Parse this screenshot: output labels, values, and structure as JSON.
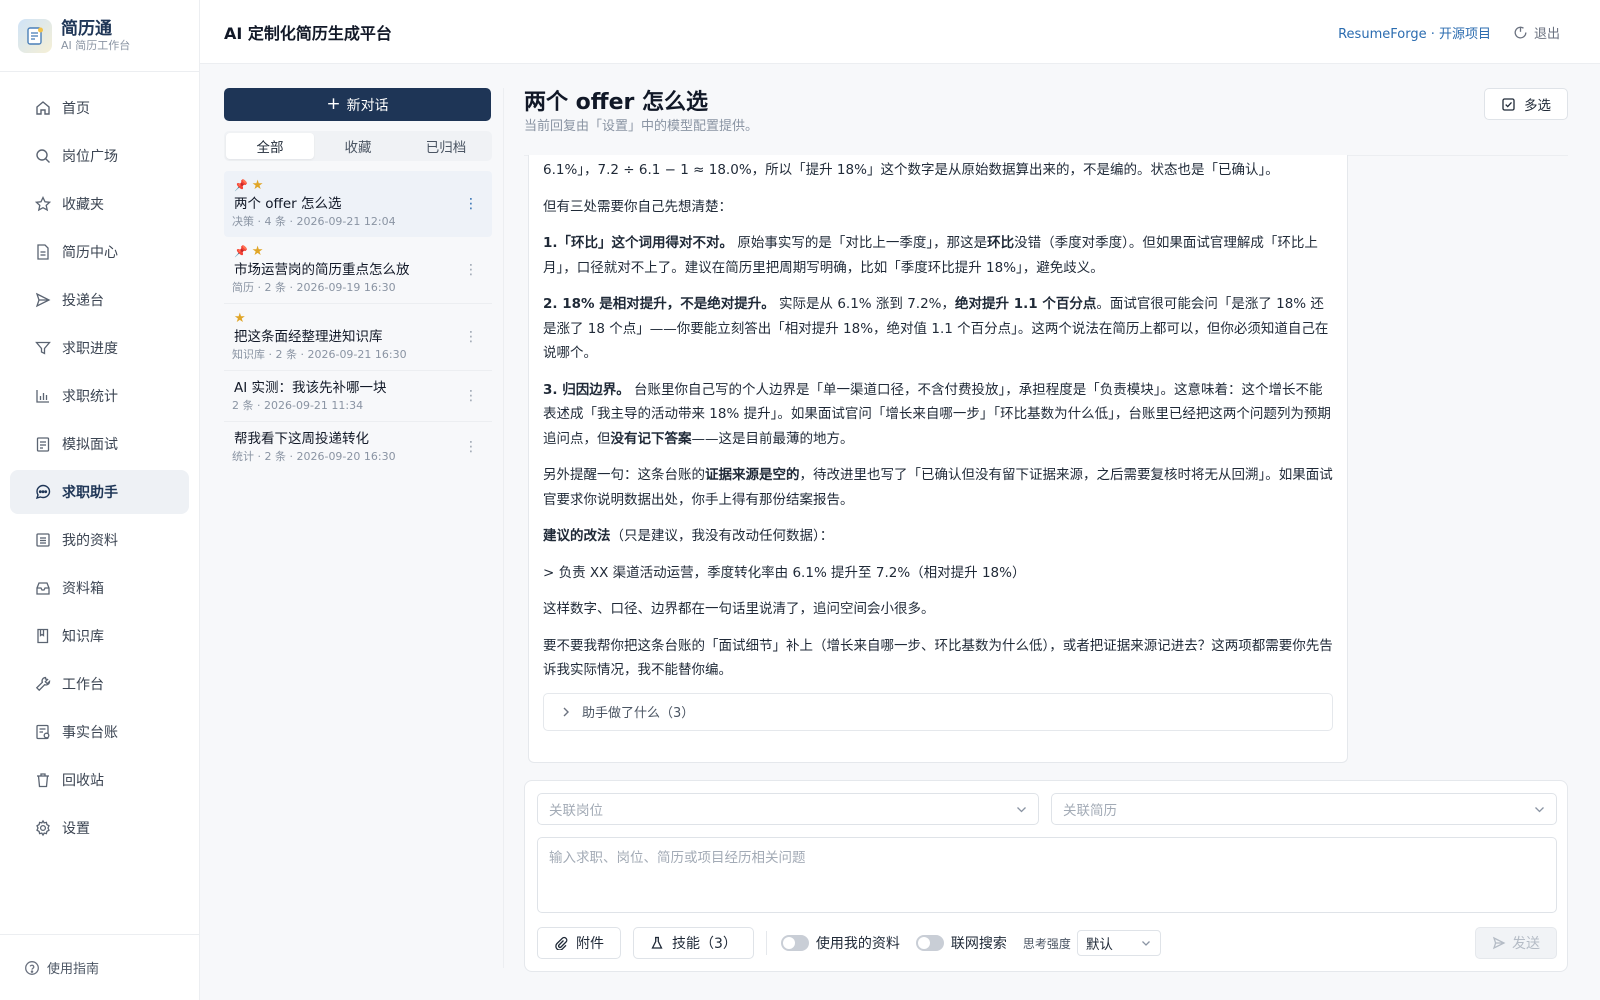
{
  "brand": {
    "name": "简历通",
    "subtitle": "AI 简历工作台"
  },
  "sidebar": {
    "items": [
      {
        "label": "首页",
        "icon": "home-icon"
      },
      {
        "label": "岗位广场",
        "icon": "search-icon"
      },
      {
        "label": "收藏夹",
        "icon": "star-icon"
      },
      {
        "label": "简历中心",
        "icon": "document-icon"
      },
      {
        "label": "投递台",
        "icon": "send-icon"
      },
      {
        "label": "求职进度",
        "icon": "filter-icon"
      },
      {
        "label": "求职统计",
        "icon": "bar-chart-icon"
      },
      {
        "label": "模拟面试",
        "icon": "clipboard-icon"
      },
      {
        "label": "求职助手",
        "icon": "chat-bubble-icon",
        "active": true
      },
      {
        "label": "我的资料",
        "icon": "list-icon"
      },
      {
        "label": "资料箱",
        "icon": "inbox-icon"
      },
      {
        "label": "知识库",
        "icon": "book-icon"
      },
      {
        "label": "工作台",
        "icon": "wrench-icon"
      },
      {
        "label": "事实台账",
        "icon": "ledger-icon"
      },
      {
        "label": "回收站",
        "icon": "trash-icon"
      },
      {
        "label": "设置",
        "icon": "gear-icon"
      }
    ],
    "guide_label": "使用指南"
  },
  "header": {
    "title": "AI 定制化简历生成平台",
    "project_link_a": "ResumeForge · ",
    "project_link_b": "开源项目",
    "logout_label": "退出"
  },
  "conversations": {
    "new_label": "新对话",
    "tabs": [
      "全部",
      "收藏",
      "已归档"
    ],
    "active_tab": "全部",
    "items": [
      {
        "title": "两个 offer 怎么选",
        "meta": "决策 · 4 条 · 2026-09-21 12:04",
        "pinned": true,
        "starred": true,
        "active": true
      },
      {
        "title": "市场运营岗的简历重点怎么放",
        "meta": "简历 · 2 条 · 2026-09-19 16:30",
        "pinned": true,
        "starred": true
      },
      {
        "title": "把这条面经整理进知识库",
        "meta": "知识库 · 2 条 · 2026-09-21 16:30",
        "pinned": false,
        "starred": true
      },
      {
        "title": "AI 实测：我该先补哪一块",
        "meta": "2 条 · 2026-09-21 11:34",
        "pinned": false,
        "starred": false
      },
      {
        "title": "帮我看下这周投递转化",
        "meta": "统计 · 2 条 · 2026-09-20 16:30",
        "pinned": false,
        "starred": false
      }
    ]
  },
  "chat": {
    "title": "两个 offer 怎么选",
    "subtitle": "当前回复由「设置」中的模型配置提供。",
    "multi_select_label": "多选",
    "message": {
      "p0": "6.1%」，7.2 ÷ 6.1 − 1 ≈ 18.0%，所以「提升 18%」这个数字是从原始数据算出来的，不是编的。状态也是「已确认」。",
      "p1": "但有三处需要你自己先想清楚：",
      "p2_bold": "1.「环比」这个词用得对不对。",
      "p2_a": " 原始事实写的是「对比上一季度」，那这是",
      "p2_bold2": "环比",
      "p2_b": "没错（季度对季度）。但如果面试官理解成「环比上月」，口径就对不上了。建议在简历里把周期写明确，比如「季度环比提升 18%」，避免歧义。",
      "p3_bold": "2. 18% 是相对提升，不是绝对提升。",
      "p3_a": " 实际是从 6.1% 涨到 7.2%，",
      "p3_bold2": "绝对提升 1.1 个百分点",
      "p3_b": "。面试官很可能会问「是涨了 18% 还是涨了 18 个点」——你要能立刻答出「相对提升 18%，绝对值 1.1 个百分点」。这两个说法在简历上都可以，但你必须知道自己在说哪个。",
      "p4_bold": "3. 归因边界。",
      "p4_a": " 台账里你自己写的个人边界是「单一渠道口径，不含付费投放」，承担程度是「负责模块」。这意味着：这个增长不能表述成「我主导的活动带来 18% 提升」。如果面试官问「增长来自哪一步」「环比基数为什么低」，台账里已经把这两个问题列为预期追问点，但",
      "p4_bold2": "没有记下答案",
      "p4_b": "——这是目前最薄的地方。",
      "p5_a": "另外提醒一句：这条台账的",
      "p5_bold": "证据来源是空的",
      "p5_b": "，待改进里也写了「已确认但没有留下证据来源，之后需要复核时将无从回溯」。如果面试官要求你说明数据出处，你手上得有那份结案报告。",
      "p6_bold": "建议的改法",
      "p6_a": "（只是建议，我没有改动任何数据）：",
      "p7": "> 负责 XX 渠道活动运营，季度转化率由 6.1% 提升至 7.2%（相对提升 18%）",
      "p8": "这样数字、口径、边界都在一句话里说清了，追问空间会小很多。",
      "p9": "要不要我帮你把这条台账的「面试细节」补上（增长来自哪一步、环比基数为什么低），或者把证据来源记进去？这两项都需要你先告诉我实际情况，我不能替你编。",
      "steps_label": "助手做了什么（3）"
    }
  },
  "composer": {
    "job_placeholder": "关联岗位",
    "resume_placeholder": "关联简历",
    "input_placeholder": "输入求职、岗位、简历或项目经历相关问题",
    "attach_label": "附件",
    "skills_label": "技能（3）",
    "use_profile_label": "使用我的资料",
    "web_search_label": "联网搜索",
    "think_label": "思考强度",
    "think_value": "默认",
    "send_label": "发送"
  }
}
